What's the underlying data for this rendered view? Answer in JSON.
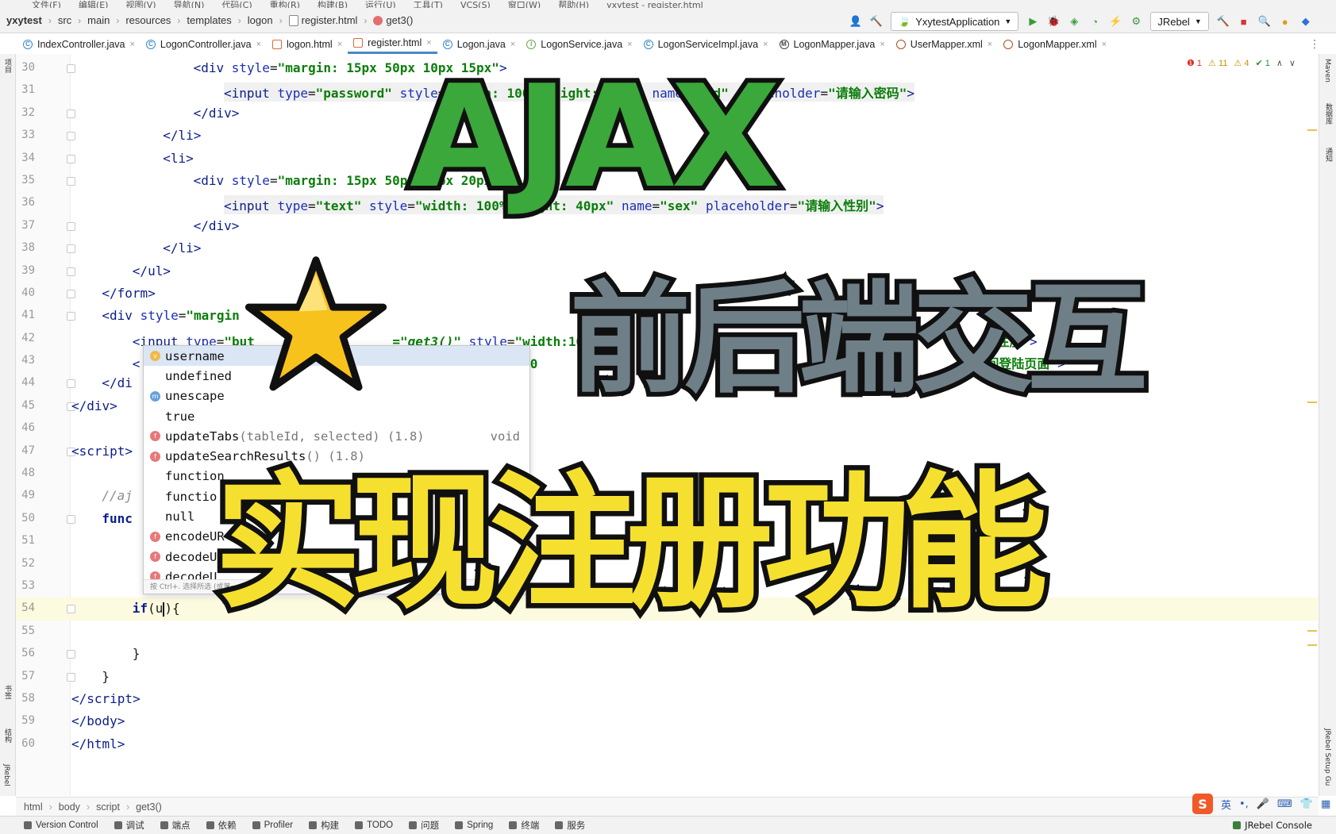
{
  "menu": [
    "文件(F)",
    "编辑(E)",
    "视图(V)",
    "导航(N)",
    "代码(C)",
    "重构(R)",
    "构建(B)",
    "运行(U)",
    "工具(T)",
    "VCS(S)",
    "窗口(W)",
    "帮助(H)",
    "yxytest - register.html"
  ],
  "breadcrumb": {
    "project": "yxytest",
    "parts": [
      "src",
      "main",
      "resources",
      "templates",
      "logon"
    ],
    "file": "register.html",
    "func": "get3()"
  },
  "toolbar": {
    "run_config": "YxytestApplication",
    "jrebel": "JRebel"
  },
  "tabs": [
    {
      "label": "IndexController.java",
      "kind": "c"
    },
    {
      "label": "LogonController.java",
      "kind": "c"
    },
    {
      "label": "logon.html",
      "kind": "h"
    },
    {
      "label": "register.html",
      "kind": "h",
      "active": true
    },
    {
      "label": "Logon.java",
      "kind": "c"
    },
    {
      "label": "LogonService.java",
      "kind": "i"
    },
    {
      "label": "LogonServiceImpl.java",
      "kind": "c"
    },
    {
      "label": "LogonMapper.java",
      "kind": "m"
    },
    {
      "label": "UserMapper.xml",
      "kind": "x"
    },
    {
      "label": "LogonMapper.xml",
      "kind": "x"
    }
  ],
  "inspections": {
    "errors": "1",
    "warnings": "11",
    "weak": "4",
    "ok": "1"
  },
  "side_left": [
    "项目",
    "书签",
    "结构",
    "JRebel"
  ],
  "side_right": [
    "Maven",
    "数据库",
    "通知",
    "JRebel Setup Gu"
  ],
  "code_lines": [
    {
      "n": "30",
      "indent": 4,
      "html": "<span class='t-tag'>&lt;div</span> <span class='t-attr'>style</span>=<span class='t-val'>\"margin: 15px 50px 10px 15px\"</span><span class='t-tag'>&gt;</span>"
    },
    {
      "n": "31",
      "indent": 5,
      "hl": true,
      "html": "<span class='t-tag'>&lt;input</span> <span class='t-attr'>type</span>=<span class='t-val'>\"password\"</span> <span class='t-attr'>style</span>=<span class='t-val'>\"width: 100%;height: 40px\"</span> <span class='t-attr'>name</span>=<span class='t-val'>\"pwd\"</span> <span class='t-attr'>placeholder</span>=<span class='t-val'>\"请输入密码\"</span><span class='t-tag'>&gt;</span>"
    },
    {
      "n": "32",
      "indent": 4,
      "html": "<span class='t-tag'>&lt;/div&gt;</span>"
    },
    {
      "n": "33",
      "indent": 3,
      "html": "<span class='t-tag'>&lt;/li&gt;</span>"
    },
    {
      "n": "34",
      "indent": 3,
      "html": "<span class='t-tag'>&lt;li&gt;</span>"
    },
    {
      "n": "35",
      "indent": 4,
      "html": "<span class='t-tag'>&lt;div</span> <span class='t-attr'>style</span>=<span class='t-val'>\"margin: 15px 50px 10px 20px\"</span><span class='t-tag'>&gt;</span>"
    },
    {
      "n": "36",
      "indent": 5,
      "hl": true,
      "html": "<span class='t-tag'>&lt;input</span> <span class='t-attr'>type</span>=<span class='t-val'>\"text\"</span> <span class='t-attr'>style</span>=<span class='t-val'>\"width: 100%;height: 40px\"</span> <span class='t-attr'>name</span>=<span class='t-val'>\"sex\"</span> <span class='t-attr'>placeholder</span>=<span class='t-val'>\"请输入性别\"</span><span class='t-tag'>&gt;</span>"
    },
    {
      "n": "37",
      "indent": 4,
      "html": "<span class='t-tag'>&lt;/div&gt;</span>"
    },
    {
      "n": "38",
      "indent": 3,
      "html": "<span class='t-tag'>&lt;/li&gt;</span>"
    },
    {
      "n": "39",
      "indent": 2,
      "html": "<span class='t-tag'>&lt;/ul&gt;</span>"
    },
    {
      "n": "40",
      "indent": 1,
      "html": "<span class='t-tag'>&lt;/form&gt;</span>"
    },
    {
      "n": "41",
      "indent": 1,
      "html": "<span class='t-tag'>&lt;div</span> <span class='t-attr'>style</span>=<span class='t-val'>\"margin</span>"
    },
    {
      "n": "42",
      "indent": 2,
      "html": "<span class='t-tag'>&lt;input</span> <span class='t-attr'>type</span>=<span class='t-val'>\"but</span>                  <span class='t-val'>=\"<i>get3()</i>\"</span> <span class='t-attr'>style</span>=<span class='t-val'>\"width:100</span>                                                     <span class='t-val'>注册\"</span><span class='t-tag'>&gt;</span>"
    },
    {
      "n": "43",
      "indent": 2,
      "html": "<span class='t-tag'>&lt;</span>                                              <span class='t-val'>th:100</span>                                                        <span class='t-val'>\"返回登陆页面\"</span><span class='t-tag'>&gt;</span>"
    },
    {
      "n": "44",
      "indent": 1,
      "html": "<span class='t-tag'>&lt;/di</span>"
    },
    {
      "n": "45",
      "indent": 0,
      "html": "<span class='t-tag'>&lt;/div&gt;</span>"
    },
    {
      "n": "46",
      "indent": 0,
      "html": ""
    },
    {
      "n": "47",
      "indent": 0,
      "html": "<span class='t-tag'>&lt;script&gt;</span>"
    },
    {
      "n": "48",
      "indent": 0,
      "html": ""
    },
    {
      "n": "49",
      "indent": 1,
      "html": "<span class='t-com'>//aj</span>"
    },
    {
      "n": "50",
      "indent": 1,
      "html": "<span class='t-kw'>func</span>"
    },
    {
      "n": "51",
      "indent": 2,
      "html": ""
    },
    {
      "n": "52",
      "indent": 2,
      "html": ""
    },
    {
      "n": "53",
      "indent": 2,
      "html": ""
    },
    {
      "n": "54",
      "indent": 2,
      "cur": true,
      "html": "<span class='t-kw'>if</span>(u<span class='caret'></span>){"
    },
    {
      "n": "55",
      "indent": 0,
      "html": ""
    },
    {
      "n": "56",
      "indent": 2,
      "html": "}"
    },
    {
      "n": "57",
      "indent": 1,
      "html": "}"
    },
    {
      "n": "58",
      "indent": 0,
      "html": "<span class='t-tag'>&lt;/script&gt;</span>"
    },
    {
      "n": "59",
      "indent": 0,
      "html": "<span class='t-tag'>&lt;/body&gt;</span>"
    },
    {
      "n": "60",
      "indent": 0,
      "html": "<span class='t-tag'>&lt;/html&gt;</span>"
    }
  ],
  "completion": {
    "items": [
      {
        "icon": "v",
        "name": "username",
        "sig": "",
        "type": ""
      },
      {
        "icon": "none",
        "name": "undefined",
        "sig": "",
        "type": ""
      },
      {
        "icon": "m",
        "name": "unescape",
        "sig": "",
        "type": ""
      },
      {
        "icon": "none",
        "name": "true",
        "sig": "",
        "type": ""
      },
      {
        "icon": "f",
        "name": "updateTabs",
        "sig": "(tableId, selected) (1.8)",
        "type": "void"
      },
      {
        "icon": "f",
        "name": "updateSearchResults",
        "sig": "() (1.8)",
        "type": ""
      },
      {
        "icon": "none",
        "name": "function",
        "sig": "",
        "type": ""
      },
      {
        "icon": "none",
        "name": "functio",
        "sig": "",
        "type": ""
      },
      {
        "icon": "none",
        "name": "null",
        "sig": "",
        "type": ""
      },
      {
        "icon": "f",
        "name": "encodeUR",
        "sig": "",
        "type": ""
      },
      {
        "icon": "f",
        "name": "decodeUR",
        "sig": "",
        "type": ""
      },
      {
        "icon": "f",
        "name": "decodeU",
        "sig": "",
        "type": ""
      }
    ],
    "hint": "按 Ctrl+. 选择所选 (或第一"
  },
  "overlay": {
    "line1": "AJAX",
    "line2": "前后端交互",
    "line3": "实现注册功能"
  },
  "bottom_crumbs": [
    "html",
    "body",
    "script",
    "get3()"
  ],
  "ime": {
    "lang": "英"
  },
  "statusbar": [
    "Version Control",
    "调试",
    "端点",
    "依赖",
    "Profiler",
    "构建",
    "TODO",
    "问题",
    "Spring",
    "终端",
    "服务"
  ],
  "statusbar_right": "JRebel Console",
  "colors": {
    "accent": "#4a88c7",
    "ajax": "#3aa83a",
    "subtitle": "#6f7f87",
    "main_title": "#f6e02f",
    "star": "#f8c21c"
  }
}
